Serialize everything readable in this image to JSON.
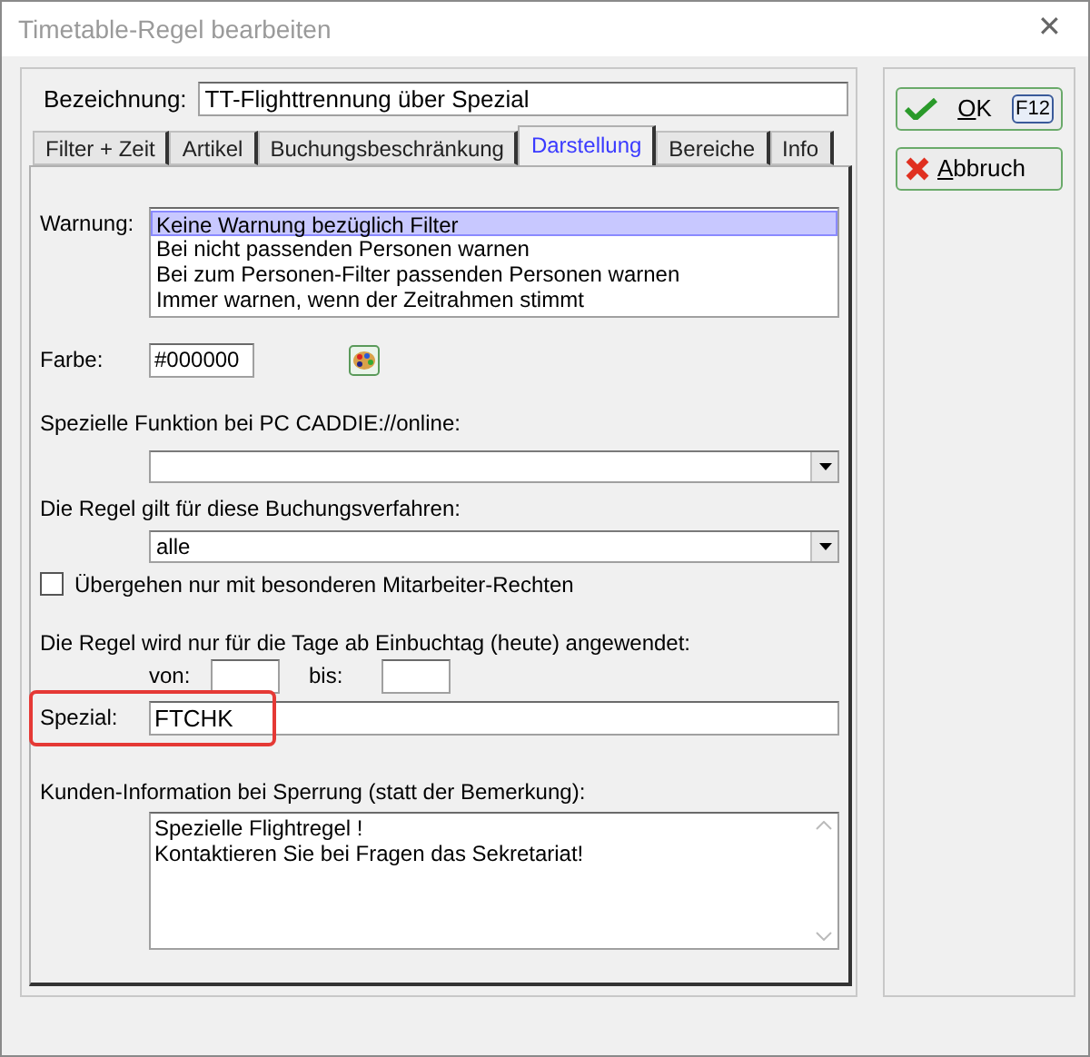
{
  "window": {
    "title": "Timetable-Regel bearbeiten",
    "close": "✕"
  },
  "name_field": {
    "label": "Bezeichnung:",
    "value": "TT-Flighttrennung über Spezial"
  },
  "tabs": [
    {
      "label": "Filter + Zeit",
      "selected": false
    },
    {
      "label": "Artikel",
      "selected": false
    },
    {
      "label": "Buchungsbeschränkung",
      "selected": false
    },
    {
      "label": "Darstellung",
      "selected": true
    },
    {
      "label": "Bereiche",
      "selected": false
    },
    {
      "label": "Info",
      "selected": false
    }
  ],
  "warning": {
    "label": "Warnung:",
    "options": [
      {
        "label": "Keine Warnung bezüglich Filter",
        "selected": true
      },
      {
        "label": "Bei nicht passenden Personen warnen",
        "selected": false
      },
      {
        "label": "Bei zum Personen-Filter passenden Personen warnen",
        "selected": false
      },
      {
        "label": "Immer warnen, wenn der Zeitrahmen stimmt",
        "selected": false
      }
    ]
  },
  "color_field": {
    "label": "Farbe:",
    "value": "#000000"
  },
  "online_function": {
    "label": "Spezielle Funktion bei PC CADDIE://online:"
  },
  "booking_methods": {
    "label": "Die Regel gilt für diese Buchungsverfahren:",
    "value": "alle"
  },
  "override_checkbox": {
    "label": "Übergehen nur mit besonderen Mitarbeiter-Rechten",
    "checked": false
  },
  "days": {
    "label": "Die Regel wird nur für die Tage ab Einbuchtag (heute) angewendet:",
    "from_label": "von:",
    "to_label": "bis:"
  },
  "special": {
    "label": "Spezial:",
    "value": "FTCHK",
    "highlighted": true
  },
  "customer_info": {
    "label": "Kunden-Information bei Sperrung (statt der Bemerkung):",
    "lines": [
      "Spezielle Flightregel !",
      "Kontaktieren Sie bei Fragen das Sekretariat!"
    ]
  },
  "buttons": [
    {
      "kind": "ok",
      "label": "OK",
      "shortcut": "F12"
    },
    {
      "kind": "cancel",
      "label": "Abbruch"
    }
  ]
}
